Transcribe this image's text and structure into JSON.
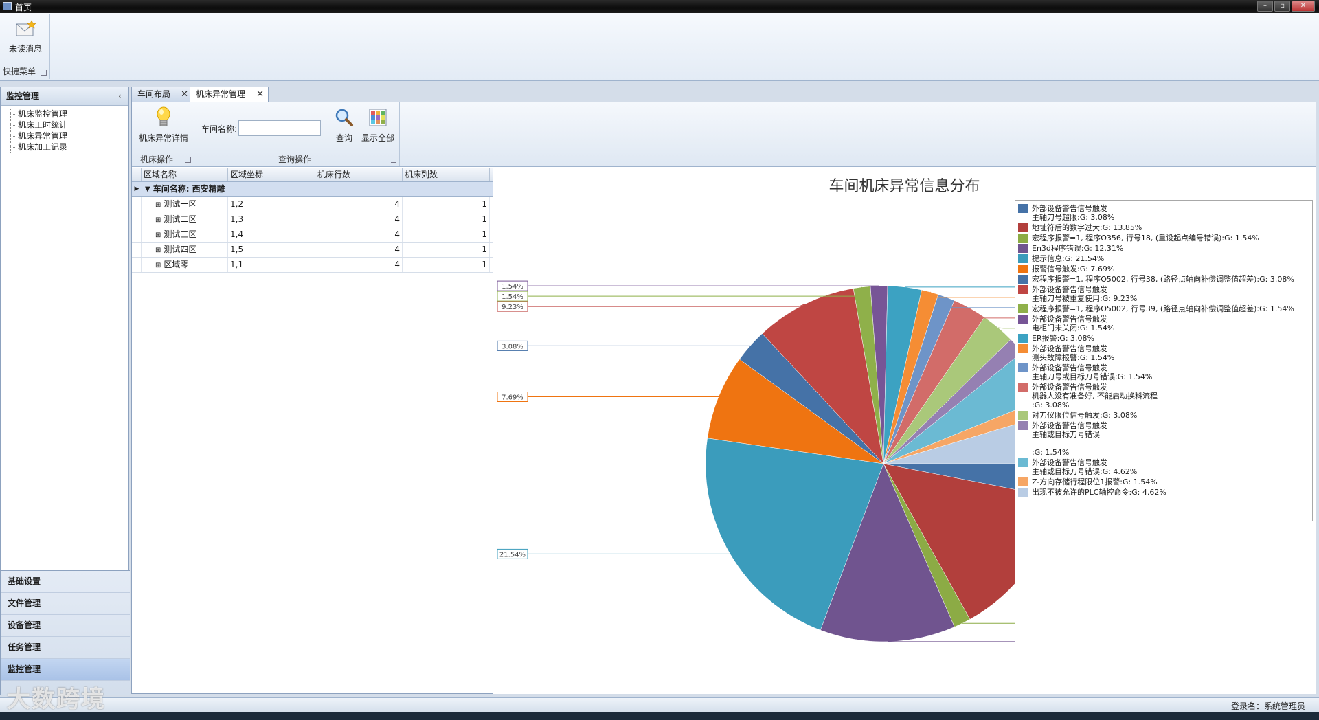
{
  "window": {
    "title": "首页"
  },
  "ribbon": {
    "unread_label": "未读消息",
    "group_label": "快捷菜单"
  },
  "sidebar": {
    "header": "监控管理",
    "collapse": "‹",
    "tree": [
      "机床监控管理",
      "机床工时统计",
      "机床异常管理",
      "机床加工记录"
    ],
    "nav": [
      "基础设置",
      "文件管理",
      "设备管理",
      "任务管理",
      "监控管理"
    ]
  },
  "tabs": [
    {
      "label": "车间布局",
      "close": "✕"
    },
    {
      "label": "机床异常管理",
      "close": "✕"
    }
  ],
  "toolbar": {
    "detail_label": "机床异常详情",
    "group1_label": "机床操作",
    "workshop_label": "车间名称:",
    "workshop_value": "",
    "query_label": "查询",
    "showall_label": "显示全部",
    "group2_label": "查询操作"
  },
  "grid": {
    "columns": [
      "区域名称",
      "区域坐标",
      "机床行数",
      "机床列数"
    ],
    "group_label": "车间名称: 西安精雕",
    "rows": [
      {
        "name": "测试一区",
        "coord": "1,2",
        "rows": "4",
        "cols": "1"
      },
      {
        "name": "测试二区",
        "coord": "1,3",
        "rows": "4",
        "cols": "1"
      },
      {
        "name": "测试三区",
        "coord": "1,4",
        "rows": "4",
        "cols": "1"
      },
      {
        "name": "测试四区",
        "coord": "1,5",
        "rows": "4",
        "cols": "1"
      },
      {
        "name": "区域零",
        "coord": "1,1",
        "rows": "4",
        "cols": "1"
      }
    ]
  },
  "chart_data": {
    "type": "pie",
    "title": "车间机床异常信息分布",
    "legend_position": "right",
    "slices": [
      {
        "label": "外部设备警告信号触发\n主轴刀号超限:G: 3.08%",
        "value": 3.08,
        "pct": "3.08%",
        "color": "#4572a7"
      },
      {
        "label": "地址符后的数字过大:G: 13.85%",
        "value": 13.85,
        "pct": "13.85%",
        "color": "#b23f3c"
      },
      {
        "label": "宏程序报警=1, 程序O356, 行号18, (重设起点编号错误):G: 1.54%",
        "value": 1.54,
        "pct": "1.54%",
        "color": "#8cab45"
      },
      {
        "label": "En3d程序错误:G: 12.31%",
        "value": 12.31,
        "pct": "12.31%",
        "color": "#70548f"
      },
      {
        "label": "提示信息:G: 21.54%",
        "value": 21.54,
        "pct": "21.54%",
        "color": "#3b9cbc"
      },
      {
        "label": "报警信号触发:G: 7.69%",
        "value": 7.69,
        "pct": "7.69%",
        "color": "#ef7411"
      },
      {
        "label": "宏程序报警=1, 程序O5002, 行号38, (路径点轴向补偿调整值超差):G: 3.08%",
        "value": 3.08,
        "pct": "3.08%",
        "color": "#4572a7"
      },
      {
        "label": "外部设备警告信号触发\n主轴刀号被重复使用:G: 9.23%",
        "value": 9.23,
        "pct": "9.23%",
        "color": "#bf4643"
      },
      {
        "label": "宏程序报警=1, 程序O5002, 行号39, (路径点轴向补偿调整值超差):G: 1.54%",
        "value": 1.54,
        "pct": "1.54%",
        "color": "#8fb04a"
      },
      {
        "label": "外部设备警告信号触发\n电柜门未关闭:G: 1.54%",
        "value": 1.54,
        "pct": "1.54%",
        "color": "#775596"
      },
      {
        "label": "ER报警:G: 3.08%",
        "value": 3.08,
        "pct": "3.08%",
        "color": "#3ca2c2"
      },
      {
        "label": "外部设备警告信号触发\n测头故障报警:G: 1.54%",
        "value": 1.54,
        "pct": "1.54%",
        "color": "#f58d34"
      },
      {
        "label": "外部设备警告信号触发\n主轴刀号或目标刀号错误:G: 1.54%",
        "value": 1.54,
        "pct": "1.54%",
        "color": "#6e94c8"
      },
      {
        "label": "外部设备警告信号触发\n机器人没有准备好, 不能启动换料流程\n:G: 3.08%",
        "value": 3.08,
        "pct": "3.08%",
        "color": "#d26c69"
      },
      {
        "label": "对刀仪限位信号触发:G: 3.08%",
        "value": 3.08,
        "pct": "3.08%",
        "color": "#aac87a"
      },
      {
        "label": "外部设备警告信号触发\n主轴或目标刀号错误\n\n:G: 1.54%",
        "value": 1.54,
        "pct": "1.54%",
        "color": "#9580b2"
      },
      {
        "label": "外部设备警告信号触发\n主轴或目标刀号错误:G: 4.62%",
        "value": 4.62,
        "pct": "4.62%",
        "color": "#6bbad3"
      },
      {
        "label": "Z-方向存储行程限位1报警:G: 1.54%",
        "value": 1.54,
        "pct": "1.54%",
        "color": "#f6a665"
      },
      {
        "label": "出现不被允许的PLC轴控命令:G: 4.62%",
        "value": 4.62,
        "pct": "4.62%",
        "color": "#b9cce4"
      }
    ]
  },
  "status": {
    "login": "登录名：系统管理员"
  },
  "watermark": "大数跨境"
}
